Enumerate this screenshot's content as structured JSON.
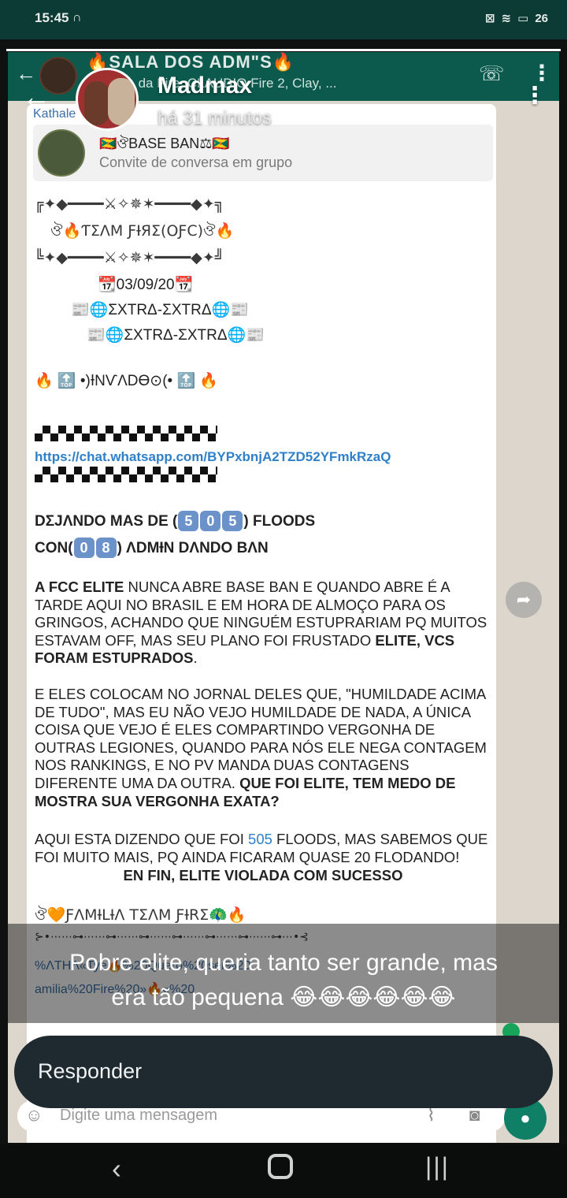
{
  "status_bar": {
    "time": "15:45",
    "alarm_icon": "headphones-icon",
    "battery": "26"
  },
  "story": {
    "progress": 1.0,
    "name": "Madmax",
    "time_ago": "há 31 minutos",
    "caption_line1": "Pobre elite, queria tanto ser grande, mas",
    "caption_line2": "era tão pequena 😂😂😂😂😂😂",
    "reply_label": "Responder"
  },
  "whatsapp": {
    "group_title": "🔥SALA DOS ADM\"S🔥",
    "group_subtitle": "ith ... da Fire, CLAUDIO Fire 2, Clay, ...",
    "sender": "Kathale",
    "invite_title": "🇬🇩ঔBASE BAN⚖🇬🇩",
    "invite_sub": "Convite de conversa em grupo",
    "deco1": "╔✦◆━━━━⚔✧✵✶━━━━◆✦╗",
    "team_line": "ঔ🔥ƬΣΛM ƑƗЯΣ(ΟƑC)ঔ🔥",
    "deco2": "╚✦◆━━━━⚔✧✵✶━━━━◆✦╝",
    "date_line": "📆03/09/20📆",
    "extra1": "📰🌐ΣXTRΔ-ΣXTRΔ🌐📰",
    "extra2": "📰🌐ΣXTRΔ-ΣXTRΔ🌐📰",
    "invaded": "🔥 🔝 •)ƗNѴΛDƟ⊙(• 🔝 🔥",
    "link": "https://chat.whatsapp.com/BYPxbnjA2TZD52YFmkRzaQ",
    "floods_prefix": "DΣJΛNDO MAS DE (",
    "floods_digits": [
      "5",
      "0",
      "5"
    ],
    "floods_suffix": ") FLOODS",
    "adm_prefix": "CON(",
    "adm_digits": [
      "0",
      "8"
    ],
    "adm_suffix": ") ΛDMƗN DΛNDO BΛN",
    "p1_bold": "A FCC ELITE",
    "p1_text": " NUNCA ABRE BASE BAN E QUANDO ABRE É A TARDE AQUI NO BRASIL E EM HORA DE ALMOÇO PARA OS GRINGOS, ACHANDO QUE NINGUÉM ESTUPRARIAM PQ MUITOS ESTAVAM OFF, MAS SEU PLANO FOI FRUSTADO ",
    "p1_bold2": "ELITE, VCS FORAM ESTUPRADOS",
    "p1_end": ".",
    "p2_text": "E ELES COLOCAM NO JORNAL DELES QUE, \"HUMILDADE ACIMA DE TUDO\", MAS EU NÃO VEJO HUMILDADE DE NADA, A ÚNICA COISA QUE VEJO É ELES COMPARTINDO VERGONHA DE OUTRAS LEGIONES, QUANDO PARA NÓS ELE NEGA CONTAGEM NOS RANKINGS, E NO PV MANDA DUAS CONTAGENS DIFERENTE UMA DA OUTRA. ",
    "p2_bold": "QUE FOI ELITE, TEM MEDO DE MOSTRA SUA VERGONHA EXATA?",
    "p3_a": "AQUI ESTA DIZENDO QUE FOI ",
    "p3_num": "505",
    "p3_b": " FLOODS, MAS SABEMOS QUE FOI MUITO MAIS, PQ AINDA FICARAM QUASE 20 FLODANDO!",
    "p3_bold": "EN FIN, ELITE VIOLADA COM SUCESSO",
    "footer_sig": "ঔ🧡ƑΛMƗLƗΛ TΣΛM ƑƗRΣ🦚🔥",
    "footer_deco": "⊱•⋯⋯⊶⋯⋯⊶⋯⋯⊶⋯⋯⊶⋯⋯⊶⋯⋯⊶⋯⋯⊶⋯•⊰",
    "footer_link1": "%ΛTHΛ«Tye🔥%20Quero%20ser%20...",
    "footer_link2": "amilia%20Fire%20»🔥«%20",
    "input_placeholder": "Digite uma mensagem"
  }
}
